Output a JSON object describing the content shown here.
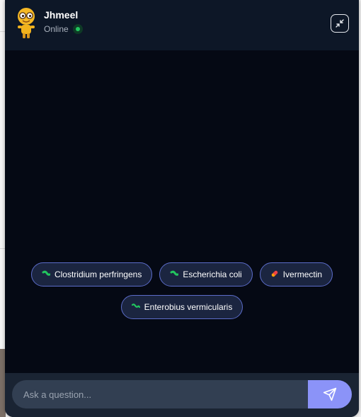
{
  "header": {
    "agent_name": "Jhmeel",
    "status": "Online"
  },
  "suggestions": [
    {
      "label": "Clostridium perfringens",
      "icon": "bacteria-icon"
    },
    {
      "label": "Escherichia coli",
      "icon": "bacteria-icon"
    },
    {
      "label": "Ivermectin",
      "icon": "pill-icon"
    },
    {
      "label": "Enterobius vermicularis",
      "icon": "worm-icon"
    }
  ],
  "input": {
    "placeholder": "Ask a question..."
  },
  "colors": {
    "accent": "#8b93f8",
    "online": "#22c55e",
    "header_bg": "#0d1727",
    "chat_bg": "#050914"
  }
}
